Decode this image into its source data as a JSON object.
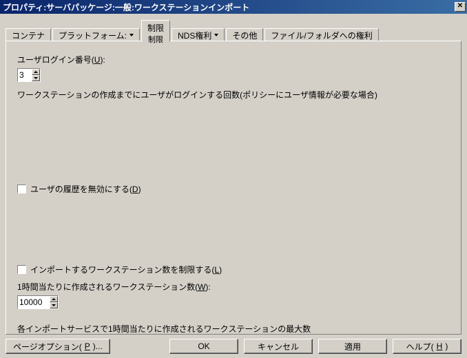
{
  "title": "プロパティ:サーバパッケージ:一般:ワークステーションインポート",
  "tabs": {
    "container": "コンテナ",
    "platform": "プラットフォーム:",
    "limits_main": "制限",
    "limits_sub": "制限",
    "nds": "NDS権利",
    "misc": "その他",
    "filefolder": "ファイル/フォルダへの権利"
  },
  "login": {
    "label_pre": "ユーザログイン番号(",
    "key": "U",
    "label_post": "):",
    "value": "3",
    "help": "ワークステーションの作成までにユーザがログインする回数(ポリシーにユーザ情報が必要な場合)"
  },
  "history": {
    "label_pre": "ユーザの履歴を無効にする(",
    "key": "D",
    "label_post": ")"
  },
  "limit": {
    "cb_pre": "インポートするワークステーション数を制限する(",
    "cb_key": "L",
    "cb_post": ")",
    "rate_pre": "1時間当たりに作成されるワークステーション数(",
    "rate_key": "W",
    "rate_post": "):",
    "value": "10000",
    "help": "各インポートサービスで1時間当たりに作成されるワークステーションの最大数"
  },
  "buttons": {
    "page_options_pre": "ページオプション(",
    "page_options_key": "P",
    "page_options_post": ")...",
    "ok": "OK",
    "cancel": "キャンセル",
    "apply": "適用",
    "help_pre": "ヘルプ(",
    "help_key": "H",
    "help_post": ")"
  }
}
